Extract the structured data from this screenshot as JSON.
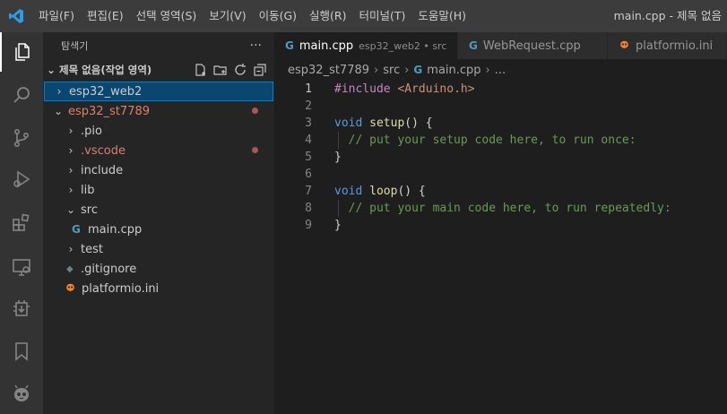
{
  "titlebar": {
    "menu": [
      "파일(F)",
      "편집(E)",
      "선택 영역(S)",
      "보기(V)",
      "이동(G)",
      "실행(R)",
      "터미널(T)",
      "도움말(H)"
    ],
    "window_title": "main.cpp - 제목 없음"
  },
  "activity_bar": [
    "explorer-icon",
    "search-icon",
    "source-control-icon",
    "run-debug-icon",
    "extensions-icon",
    "remote-explorer-icon",
    "platformio-device-icon",
    "bookmark-icon",
    "platformio-alien-icon"
  ],
  "sidebar": {
    "title": "탐색기",
    "more": "···",
    "workspace": "제목 없음(작업 영역)",
    "tree": [
      {
        "label": "esp32_web2",
        "chev": "›",
        "indent": 0
      },
      {
        "label": "esp32_st7789",
        "chev": "⌄",
        "indent": 0
      },
      {
        "label": ".pio",
        "chev": "›",
        "indent": 1
      },
      {
        "label": ".vscode",
        "chev": "›",
        "indent": 1
      },
      {
        "label": "include",
        "chev": "›",
        "indent": 1
      },
      {
        "label": "lib",
        "chev": "›",
        "indent": 1
      },
      {
        "label": "src",
        "chev": "⌄",
        "indent": 1
      },
      {
        "label": "main.cpp",
        "chev": "",
        "indent": 2
      },
      {
        "label": "test",
        "chev": "›",
        "indent": 1
      },
      {
        "label": ".gitignore",
        "chev": "",
        "indent": 1
      },
      {
        "label": "platformio.ini",
        "chev": "",
        "indent": 1
      }
    ]
  },
  "tabs": [
    {
      "label": "main.cpp",
      "desc": "esp32_web2 • src"
    },
    {
      "label": "WebRequest.cpp",
      "desc": ""
    },
    {
      "label": "platformio.ini",
      "desc": ""
    }
  ],
  "breadcrumb": [
    "esp32_st7789",
    "src",
    "main.cpp",
    "..."
  ],
  "editor": {
    "line_numbers": [
      "1",
      "2",
      "3",
      "4",
      "5",
      "6",
      "7",
      "8",
      "9"
    ],
    "l1_a": "#include ",
    "l1_b": "<Arduino.h>",
    "l3_a": "void",
    "l3_b": " setup",
    "l3_c": "() {",
    "l4": "// put your setup code here, to run once:",
    "l5": "}",
    "l7_a": "void",
    "l7_b": " loop",
    "l7_c": "() {",
    "l8": "// put your main code here, to run repeatedly:",
    "l9": "}"
  },
  "colors": {
    "accent": "#007acc",
    "selection": "#094771",
    "modified_dot": "#a45a50"
  }
}
